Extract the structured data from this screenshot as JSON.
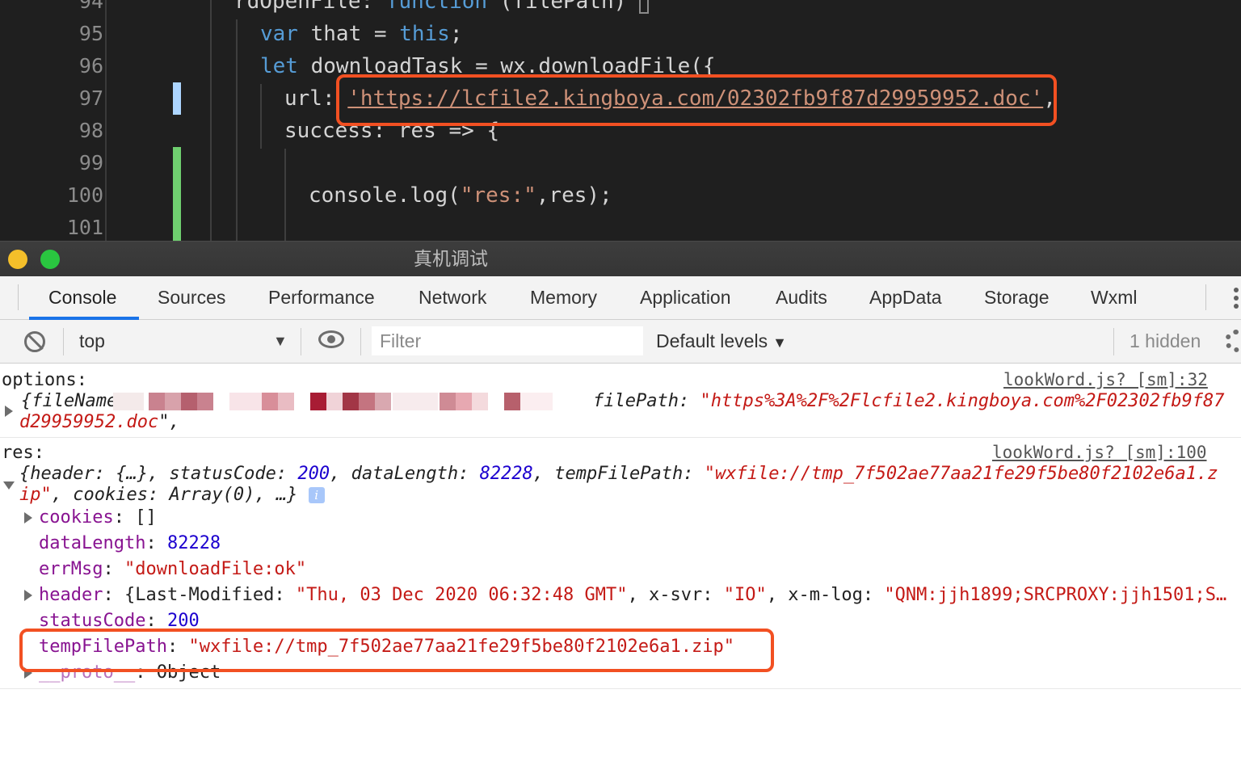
{
  "editor": {
    "lines": [
      {
        "number": "94",
        "code_parts": [
          "rdOpenFile: ",
          "function",
          " (filePath) "
        ]
      },
      {
        "number": "95",
        "code_parts": [
          "var",
          " that = ",
          "this",
          ";"
        ]
      },
      {
        "number": "96",
        "code_parts": [
          "let",
          " downloadTask = wx.downloadFile({"
        ]
      },
      {
        "number": "97",
        "code_parts": [
          "url: ",
          "'https://lcfile2.kingboya.com/02302fb9f87d29959952.doc'",
          ","
        ]
      },
      {
        "number": "98",
        "code_parts": [
          "success: res => {"
        ]
      },
      {
        "number": "99",
        "code_parts": [
          ""
        ]
      },
      {
        "number": "100",
        "code_parts": [
          "console.log(",
          "\"res:\"",
          ",res);"
        ]
      },
      {
        "number": "101",
        "code_parts": [
          ""
        ]
      }
    ],
    "colors": {
      "background": "#1f1f1f",
      "keyword": "#569cd6",
      "string": "#ce9178",
      "modified_marker": "#add6ff",
      "added_marker": "#6fcf6f",
      "highlight_box": "#f25022"
    }
  },
  "window": {
    "title": "真机调试"
  },
  "tabs": [
    {
      "label": "Console",
      "active": true
    },
    {
      "label": "Sources"
    },
    {
      "label": "Performance"
    },
    {
      "label": "Network"
    },
    {
      "label": "Memory"
    },
    {
      "label": "Application"
    },
    {
      "label": "Audits"
    },
    {
      "label": "AppData"
    },
    {
      "label": "Storage"
    },
    {
      "label": "Wxml"
    }
  ],
  "toolbar": {
    "context": "top",
    "filter_placeholder": "Filter",
    "levels": "Default levels",
    "hidden": "1 hidden"
  },
  "console": {
    "msg1": {
      "label": "options:",
      "source": "lookWord.js? [sm]:32",
      "line1_a": "{fileName",
      "line1_b": "filePath",
      "line1_c": "\"https%3A%2F%2Flcfile2.kingboya.com%2F02302fb9f87",
      "line2": "d29959952.doc",
      "line2_end": "\","
    },
    "msg2": {
      "label": "res:",
      "source": "lookWord.js? [sm]:100",
      "summary1": [
        "{header: {…}, statusCode: ",
        "200",
        ", dataLength: ",
        "82228",
        ", tempFilePath: ",
        "\"wxfile://tmp_7f502ae77aa21fe29f5be80f2102e6a1.z"
      ],
      "summary2": [
        "ip\"",
        ", cookies: Array(0), …}"
      ],
      "info_badge": "i",
      "props": {
        "cookies_key": "cookies",
        "cookies_val": "[]",
        "dataLength_key": "dataLength",
        "dataLength_val": "82228",
        "errMsg_key": "errMsg",
        "errMsg_val": "\"downloadFile:ok\"",
        "header_key": "header",
        "header_val_a": "{Last-Modified: ",
        "header_val_b": "\"Thu, 03 Dec 2020 06:32:48 GMT\"",
        "header_val_c": ", x-svr: ",
        "header_val_d": "\"IO\"",
        "header_val_e": ", x-m-log: ",
        "header_val_f": "\"QNM:jjh1899;SRCPROXY:jjh1501;S…",
        "statusCode_key": "statusCode",
        "statusCode_val": "200",
        "tempFilePath_key": "tempFilePath",
        "tempFilePath_val": "\"wxfile://tmp_7f502ae77aa21fe29f5be80f2102e6a1.zip\"",
        "proto_key": "__proto__",
        "proto_val": "Object"
      }
    }
  }
}
